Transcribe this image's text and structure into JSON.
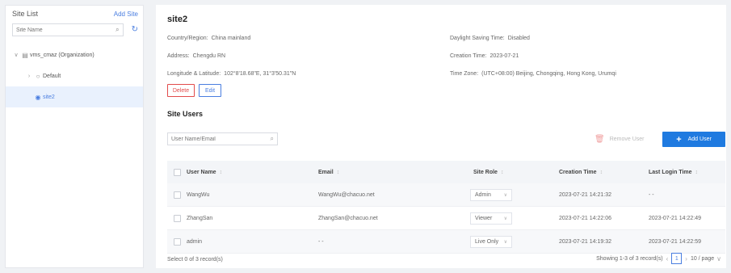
{
  "sidebar": {
    "title": "Site List",
    "add_site": "Add Site",
    "search_placeholder": "Site Name",
    "tree": [
      {
        "label": "vms_cmaz (Organization)",
        "icon": "organization-icon"
      },
      {
        "label": "Default",
        "icon": "location-outline-icon"
      },
      {
        "label": "site2",
        "icon": "location-pin-icon",
        "selected": true
      }
    ]
  },
  "site": {
    "name": "site2",
    "country_label": "Country/Region:",
    "country_value": "China mainland",
    "address_label": "Address:",
    "address_value": "Chengdu RN",
    "coords_label": "Longitude & Latitude:",
    "coords_value": "102°8'18.68\"E, 31°3'50.31\"N",
    "dst_label": "Daylight Saving Time:",
    "dst_value": "Disabled",
    "creation_label": "Creation Time:",
    "creation_value": "2023-07-21",
    "timezone_label": "Time Zone:",
    "timezone_value": "(UTC+08:00) Beijing, Chongqing, Hong Kong, Urumqi",
    "delete_label": "Delete",
    "edit_label": "Edit"
  },
  "users": {
    "section_title": "Site Users",
    "search_placeholder": "User Name/Email",
    "remove_label": "Remove User",
    "add_label": "Add User",
    "columns": [
      "User Name",
      "Email",
      "Site Role",
      "Creation Time",
      "Last Login Time"
    ],
    "rows": [
      {
        "name": "WangWu",
        "email": "WangWu@chacuo.net",
        "role": "Admin",
        "created": "2023-07-21 14:21:32",
        "last_login": "- -"
      },
      {
        "name": "ZhangSan",
        "email": "ZhangSan@chacuo.net",
        "role": "Viewer",
        "created": "2023-07-21 14:22:06",
        "last_login": "2023-07-21 14:22:49"
      },
      {
        "name": "admin",
        "email": "- -",
        "role": "Live Only",
        "created": "2023-07-21 14:19:32",
        "last_login": "2023-07-21 14:22:59"
      }
    ],
    "selected_text": "Select 0 of 3 record(s)",
    "showing_text": "Showing 1-3 of 3 record(s)",
    "page": "1",
    "page_size": "10 / page"
  }
}
